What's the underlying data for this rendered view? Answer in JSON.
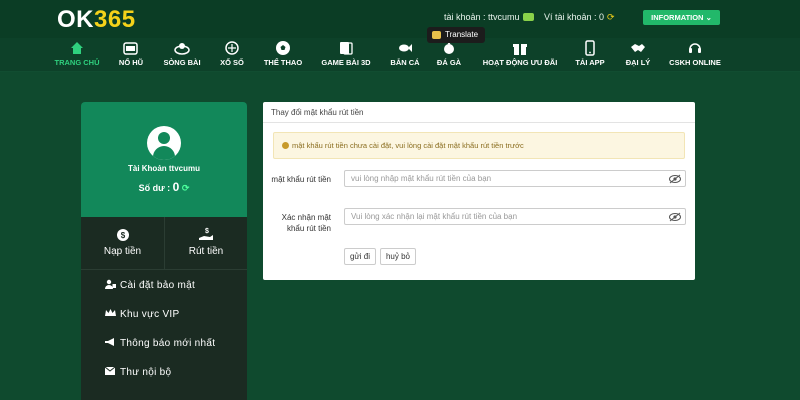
{
  "header": {
    "logo_text": "OK",
    "logo_num": "365",
    "account_label": "tài khoản : ttvcumu",
    "wallet_label": "Ví tài khoản : 0",
    "info_button": "INFORMATION",
    "translate_tooltip": "Translate"
  },
  "nav": {
    "items": [
      {
        "label": "TRANG CHỦ",
        "icon": "home-icon",
        "active": true
      },
      {
        "label": "NỔ HŨ",
        "icon": "slot-icon"
      },
      {
        "label": "SÒNG BÀI",
        "icon": "casino-icon"
      },
      {
        "label": "XỔ SỐ",
        "icon": "lottery-icon"
      },
      {
        "label": "THỂ THAO",
        "icon": "soccer-icon"
      },
      {
        "label": "GAME BÀI 3D",
        "icon": "cards-icon"
      },
      {
        "label": "BẮN CÁ",
        "icon": "fish-icon"
      },
      {
        "label": "ĐÁ GÀ",
        "icon": "rooster-icon"
      },
      {
        "label": "HOẠT ĐỘNG ƯU ĐÃI",
        "icon": "gift-icon"
      },
      {
        "label": "TẢI APP",
        "icon": "phone-icon"
      },
      {
        "label": "ĐẠI LÝ",
        "icon": "handshake-icon"
      },
      {
        "label": "CSKH ONLINE",
        "icon": "headset-icon"
      }
    ]
  },
  "profile": {
    "account_name": "Tài Khoản ttvcumu",
    "balance_label": "Số dư :",
    "balance_value": "0"
  },
  "actions": {
    "deposit": "Nạp tiền",
    "withdraw": "Rút tiền"
  },
  "menu": {
    "items": [
      {
        "label": "Cài đặt bảo mật",
        "icon": "user-lock-icon"
      },
      {
        "label": "Khu vực VIP",
        "icon": "crown-icon"
      },
      {
        "label": "Thông báo mới nhất",
        "icon": "megaphone-icon"
      },
      {
        "label": "Thư nội bộ",
        "icon": "envelope-icon"
      }
    ]
  },
  "form": {
    "title": "Thay đổi mật khẩu rút tiền",
    "alert": "mật khẩu rút tiền chưa cài đặt, vui lòng cài đặt mật khẩu rút tiền trước",
    "password_label": "mật khẩu rút tiền",
    "password_placeholder": "vui lòng nhập mật khẩu rút tiền của bạn",
    "confirm_label": "Xác nhận mật khẩu rút tiền",
    "confirm_placeholder": "Vui lòng xác nhận lại mật khẩu rút tiền của bạn",
    "submit": "gửi đi",
    "cancel": "huỷ bỏ"
  },
  "colors": {
    "page_bg": "#0f4a2e",
    "header_bg": "#0b3d25",
    "accent": "#22b86a",
    "active_nav": "#2fd07e",
    "logo_accent": "#f5d21a",
    "profile_bg": "#12885a",
    "menu_bg": "#1b2b22"
  }
}
